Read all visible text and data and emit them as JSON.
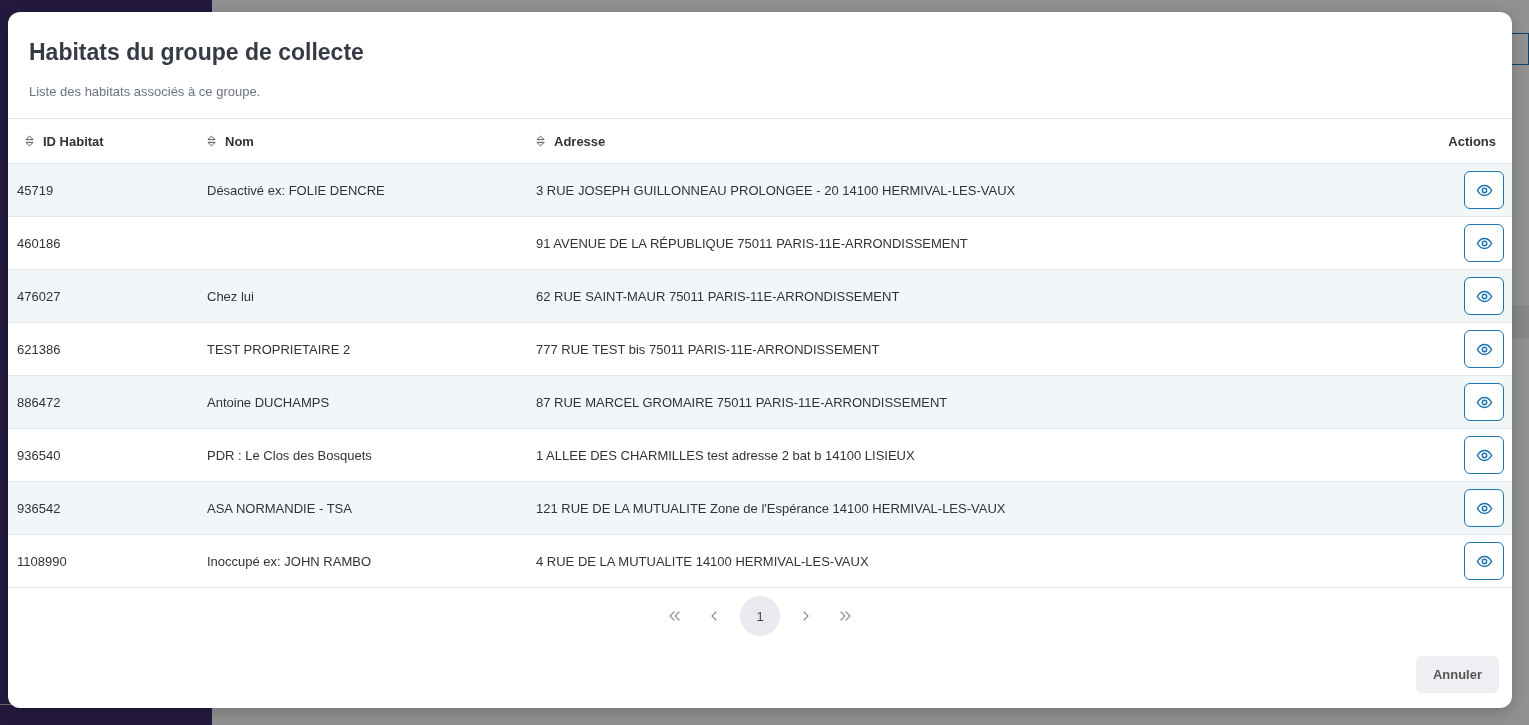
{
  "dialog": {
    "title": "Habitats du groupe de collecte",
    "subtitle": "Liste des habitats associés à ce groupe.",
    "table": {
      "columns": [
        {
          "label": "ID Habitat",
          "sortable": true
        },
        {
          "label": "Nom",
          "sortable": true
        },
        {
          "label": "Adresse",
          "sortable": true
        },
        {
          "label": "Actions",
          "sortable": false
        }
      ],
      "rows": [
        {
          "id": "45719",
          "name": "Désactivé ex: FOLIE DENCRE",
          "address": "3 RUE JOSEPH GUILLONNEAU PROLONGEE - 20 14100 HERMIVAL-LES-VAUX"
        },
        {
          "id": "460186",
          "address": "91 AVENUE DE LA RÉPUBLIQUE 75011 PARIS-11E-ARRONDISSEMENT"
        },
        {
          "id": "476027",
          "name": "Chez lui",
          "address": "62 RUE SAINT-MAUR 75011 PARIS-11E-ARRONDISSEMENT"
        },
        {
          "id": "621386",
          "name": "TEST PROPRIETAIRE 2",
          "address": "777 RUE TEST bis 75011 PARIS-11E-ARRONDISSEMENT"
        },
        {
          "id": "886472",
          "name": "Antoine DUCHAMPS",
          "address": "87 RUE MARCEL GROMAIRE 75011 PARIS-11E-ARRONDISSEMENT"
        },
        {
          "id": "936540",
          "name": "PDR : Le Clos des Bosquets",
          "address": "1 ALLEE DES CHARMILLES test adresse 2 bat b 14100 LISIEUX"
        },
        {
          "id": "936542",
          "name": "ASA NORMANDIE - TSA",
          "address": "121 RUE DE LA MUTUALITE Zone de l'Espérance 14100 HERMIVAL-LES-VAUX"
        },
        {
          "id": "1108990",
          "name": "Inoccupé ex: JOHN RAMBO",
          "address": "4 RUE DE LA MUTUALITE 14100 HERMIVAL-LES-VAUX"
        }
      ]
    },
    "pagination": {
      "pages": [
        {
          "label": "1",
          "selected": true
        }
      ]
    },
    "buttons": [
      {
        "label": "Annuler"
      }
    ]
  }
}
